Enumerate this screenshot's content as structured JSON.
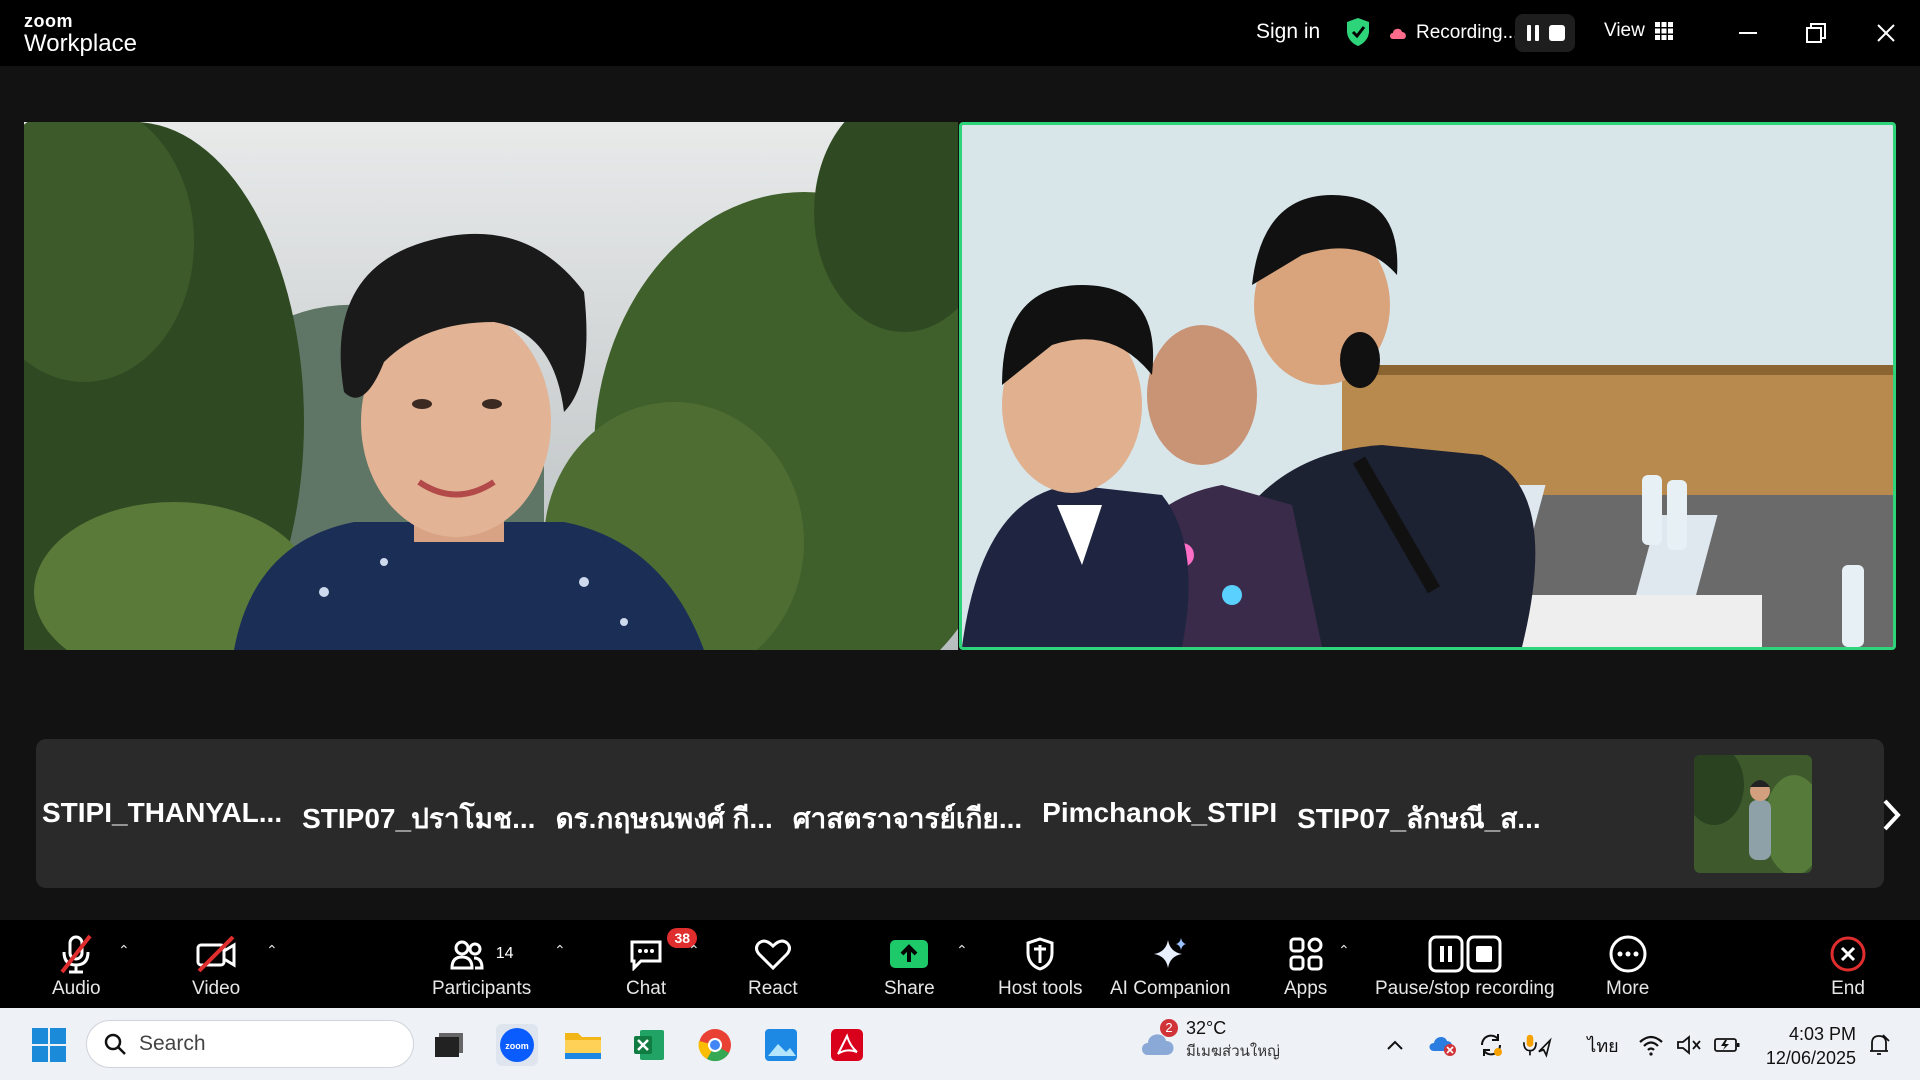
{
  "title_bar": {
    "brand_top": "zoom",
    "brand_bottom": "Workplace",
    "sign_in": "Sign in",
    "recording_label": "Recording...",
    "view_label": "View"
  },
  "participants_strip": {
    "names": [
      "STIPI_THANYAL...",
      "STIP07_ปราโมช...",
      "ดร.กฤษณพงศ์ กี...",
      "ศาสตราจารย์เกีย...",
      "Pimchanok_STIPI",
      "STIP07_ลักษณี_ส..."
    ]
  },
  "toolbar": {
    "audio": "Audio",
    "video": "Video",
    "participants": "Participants",
    "participants_count": "14",
    "chat": "Chat",
    "chat_badge": "38",
    "react": "React",
    "share": "Share",
    "host_tools": "Host tools",
    "ai_companion": "AI Companion",
    "apps": "Apps",
    "pause_stop": "Pause/stop recording",
    "more": "More",
    "end": "End"
  },
  "taskbar": {
    "search_placeholder": "Search",
    "weather_badge": "2",
    "temperature": "32°C",
    "weather_location": "มีเมฆส่วนใหญ่",
    "language": "ไทย",
    "time": "4:03 PM",
    "date": "12/06/2025"
  },
  "colors": {
    "active_speaker_border": "#2ed47a",
    "share_green": "#1ec96a",
    "end_red": "#e02d2d",
    "recording_pink": "#ff6b8a"
  }
}
